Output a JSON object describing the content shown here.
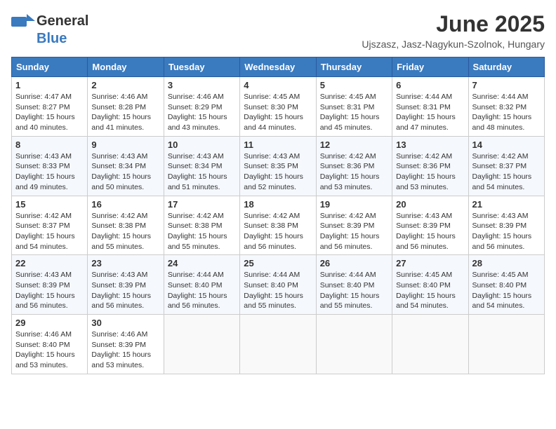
{
  "header": {
    "logo_general": "General",
    "logo_blue": "Blue",
    "month": "June 2025",
    "location": "Ujszasz, Jasz-Nagykun-Szolnok, Hungary"
  },
  "days_of_week": [
    "Sunday",
    "Monday",
    "Tuesday",
    "Wednesday",
    "Thursday",
    "Friday",
    "Saturday"
  ],
  "weeks": [
    [
      {
        "day": "1",
        "sunrise": "4:47 AM",
        "sunset": "8:27 PM",
        "daylight": "15 hours and 40 minutes."
      },
      {
        "day": "2",
        "sunrise": "4:46 AM",
        "sunset": "8:28 PM",
        "daylight": "15 hours and 41 minutes."
      },
      {
        "day": "3",
        "sunrise": "4:46 AM",
        "sunset": "8:29 PM",
        "daylight": "15 hours and 43 minutes."
      },
      {
        "day": "4",
        "sunrise": "4:45 AM",
        "sunset": "8:30 PM",
        "daylight": "15 hours and 44 minutes."
      },
      {
        "day": "5",
        "sunrise": "4:45 AM",
        "sunset": "8:31 PM",
        "daylight": "15 hours and 45 minutes."
      },
      {
        "day": "6",
        "sunrise": "4:44 AM",
        "sunset": "8:31 PM",
        "daylight": "15 hours and 47 minutes."
      },
      {
        "day": "7",
        "sunrise": "4:44 AM",
        "sunset": "8:32 PM",
        "daylight": "15 hours and 48 minutes."
      }
    ],
    [
      {
        "day": "8",
        "sunrise": "4:43 AM",
        "sunset": "8:33 PM",
        "daylight": "15 hours and 49 minutes."
      },
      {
        "day": "9",
        "sunrise": "4:43 AM",
        "sunset": "8:34 PM",
        "daylight": "15 hours and 50 minutes."
      },
      {
        "day": "10",
        "sunrise": "4:43 AM",
        "sunset": "8:34 PM",
        "daylight": "15 hours and 51 minutes."
      },
      {
        "day": "11",
        "sunrise": "4:43 AM",
        "sunset": "8:35 PM",
        "daylight": "15 hours and 52 minutes."
      },
      {
        "day": "12",
        "sunrise": "4:42 AM",
        "sunset": "8:36 PM",
        "daylight": "15 hours and 53 minutes."
      },
      {
        "day": "13",
        "sunrise": "4:42 AM",
        "sunset": "8:36 PM",
        "daylight": "15 hours and 53 minutes."
      },
      {
        "day": "14",
        "sunrise": "4:42 AM",
        "sunset": "8:37 PM",
        "daylight": "15 hours and 54 minutes."
      }
    ],
    [
      {
        "day": "15",
        "sunrise": "4:42 AM",
        "sunset": "8:37 PM",
        "daylight": "15 hours and 54 minutes."
      },
      {
        "day": "16",
        "sunrise": "4:42 AM",
        "sunset": "8:38 PM",
        "daylight": "15 hours and 55 minutes."
      },
      {
        "day": "17",
        "sunrise": "4:42 AM",
        "sunset": "8:38 PM",
        "daylight": "15 hours and 55 minutes."
      },
      {
        "day": "18",
        "sunrise": "4:42 AM",
        "sunset": "8:38 PM",
        "daylight": "15 hours and 56 minutes."
      },
      {
        "day": "19",
        "sunrise": "4:42 AM",
        "sunset": "8:39 PM",
        "daylight": "15 hours and 56 minutes."
      },
      {
        "day": "20",
        "sunrise": "4:43 AM",
        "sunset": "8:39 PM",
        "daylight": "15 hours and 56 minutes."
      },
      {
        "day": "21",
        "sunrise": "4:43 AM",
        "sunset": "8:39 PM",
        "daylight": "15 hours and 56 minutes."
      }
    ],
    [
      {
        "day": "22",
        "sunrise": "4:43 AM",
        "sunset": "8:39 PM",
        "daylight": "15 hours and 56 minutes."
      },
      {
        "day": "23",
        "sunrise": "4:43 AM",
        "sunset": "8:39 PM",
        "daylight": "15 hours and 56 minutes."
      },
      {
        "day": "24",
        "sunrise": "4:44 AM",
        "sunset": "8:40 PM",
        "daylight": "15 hours and 56 minutes."
      },
      {
        "day": "25",
        "sunrise": "4:44 AM",
        "sunset": "8:40 PM",
        "daylight": "15 hours and 55 minutes."
      },
      {
        "day": "26",
        "sunrise": "4:44 AM",
        "sunset": "8:40 PM",
        "daylight": "15 hours and 55 minutes."
      },
      {
        "day": "27",
        "sunrise": "4:45 AM",
        "sunset": "8:40 PM",
        "daylight": "15 hours and 54 minutes."
      },
      {
        "day": "28",
        "sunrise": "4:45 AM",
        "sunset": "8:40 PM",
        "daylight": "15 hours and 54 minutes."
      }
    ],
    [
      {
        "day": "29",
        "sunrise": "4:46 AM",
        "sunset": "8:40 PM",
        "daylight": "15 hours and 53 minutes."
      },
      {
        "day": "30",
        "sunrise": "4:46 AM",
        "sunset": "8:39 PM",
        "daylight": "15 hours and 53 minutes."
      },
      null,
      null,
      null,
      null,
      null
    ]
  ],
  "labels": {
    "sunrise": "Sunrise:",
    "sunset": "Sunset:",
    "daylight": "Daylight:"
  }
}
